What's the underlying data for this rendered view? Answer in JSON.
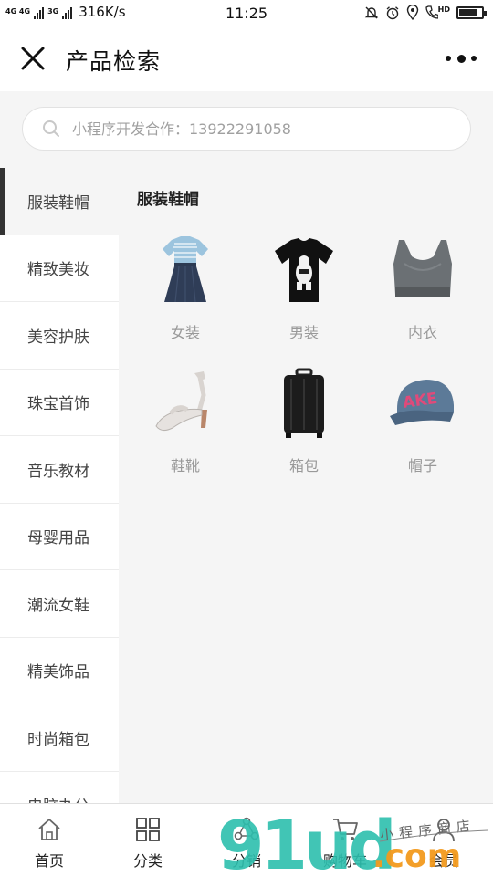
{
  "status_bar": {
    "network_top": "4G 4G",
    "network_small": "3G",
    "speed": "316K/s",
    "time": "11:25",
    "hd": "HD",
    "battery_level": 0.8
  },
  "header": {
    "title": "产品检索"
  },
  "search": {
    "placeholder": "小程序开发合作：13922291058"
  },
  "sidebar": {
    "items": [
      {
        "label": "服装鞋帽",
        "active": true
      },
      {
        "label": "精致美妆"
      },
      {
        "label": "美容护肤"
      },
      {
        "label": "珠宝首饰"
      },
      {
        "label": "音乐教材"
      },
      {
        "label": "母婴用品"
      },
      {
        "label": "潮流女鞋"
      },
      {
        "label": "精美饰品"
      },
      {
        "label": "时尚箱包"
      },
      {
        "label": "电脑办公"
      }
    ]
  },
  "content": {
    "section_title": "服装鞋帽",
    "products": [
      {
        "label": "女装",
        "icon": "dress-icon"
      },
      {
        "label": "男装",
        "icon": "tshirt-icon"
      },
      {
        "label": "内衣",
        "icon": "sports-bra-icon"
      },
      {
        "label": "鞋靴",
        "icon": "sandal-icon"
      },
      {
        "label": "箱包",
        "icon": "suitcase-icon"
      },
      {
        "label": "帽子",
        "icon": "cap-icon"
      }
    ]
  },
  "tabbar": {
    "tabs": [
      {
        "label": "首页",
        "icon": "home-icon"
      },
      {
        "label": "分类",
        "icon": "grid-icon"
      },
      {
        "label": "分销",
        "icon": "share-icon"
      },
      {
        "label": "购物车",
        "icon": "cart-icon"
      },
      {
        "label": "会员",
        "icon": "member-icon"
      }
    ]
  },
  "watermark": {
    "main": "91ud",
    "suffix": ".com",
    "handwritten": "小程序商店"
  },
  "colors": {
    "accent_dark": "#333333",
    "background": "#f5f5f5",
    "watermark_teal": "#2dbfae",
    "watermark_orange": "#f39a1e"
  }
}
